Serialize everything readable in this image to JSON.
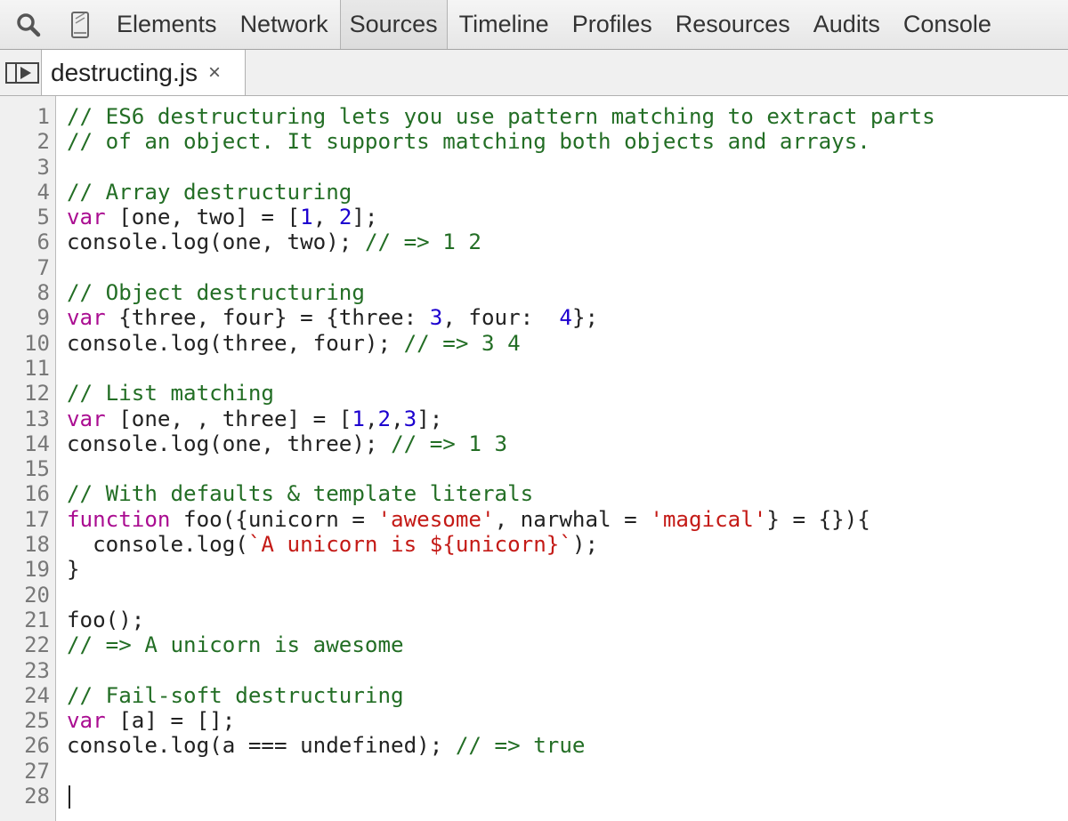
{
  "toolbar": {
    "search_icon": "magnifier-icon",
    "device_icon": "mobile-device-icon",
    "tabs": [
      {
        "label": "Elements",
        "selected": false
      },
      {
        "label": "Network",
        "selected": false
      },
      {
        "label": "Sources",
        "selected": true
      },
      {
        "label": "Timeline",
        "selected": false
      },
      {
        "label": "Profiles",
        "selected": false
      },
      {
        "label": "Resources",
        "selected": false
      },
      {
        "label": "Audits",
        "selected": false
      },
      {
        "label": "Console",
        "selected": false
      }
    ]
  },
  "file_bar": {
    "navigator_icon": "navigator-toggle-icon",
    "file_name": "destructing.js",
    "close_label": "×"
  },
  "colors": {
    "comment": "#236e25",
    "keyword": "#aa0d91",
    "number": "#1c00cf",
    "string": "#c41a16",
    "text": "#222222"
  },
  "editor": {
    "lines": [
      {
        "n": "1",
        "tokens": [
          {
            "t": "comment",
            "v": "// ES6 destructuring lets you use pattern matching to extract parts"
          }
        ]
      },
      {
        "n": "2",
        "tokens": [
          {
            "t": "comment",
            "v": "// of an object. It supports matching both objects and arrays."
          }
        ]
      },
      {
        "n": "3",
        "tokens": []
      },
      {
        "n": "4",
        "tokens": [
          {
            "t": "comment",
            "v": "// Array destructuring"
          }
        ]
      },
      {
        "n": "5",
        "tokens": [
          {
            "t": "keyword",
            "v": "var"
          },
          {
            "t": "plain",
            "v": " [one, two] = ["
          },
          {
            "t": "number",
            "v": "1"
          },
          {
            "t": "plain",
            "v": ", "
          },
          {
            "t": "number",
            "v": "2"
          },
          {
            "t": "plain",
            "v": "];"
          }
        ]
      },
      {
        "n": "6",
        "tokens": [
          {
            "t": "plain",
            "v": "console.log(one, two); "
          },
          {
            "t": "comment",
            "v": "// => 1 2"
          }
        ]
      },
      {
        "n": "7",
        "tokens": []
      },
      {
        "n": "8",
        "tokens": [
          {
            "t": "comment",
            "v": "// Object destructuring"
          }
        ]
      },
      {
        "n": "9",
        "tokens": [
          {
            "t": "keyword",
            "v": "var"
          },
          {
            "t": "plain",
            "v": " {three, four} = {three: "
          },
          {
            "t": "number",
            "v": "3"
          },
          {
            "t": "plain",
            "v": ", four:  "
          },
          {
            "t": "number",
            "v": "4"
          },
          {
            "t": "plain",
            "v": "};"
          }
        ]
      },
      {
        "n": "10",
        "tokens": [
          {
            "t": "plain",
            "v": "console.log(three, four); "
          },
          {
            "t": "comment",
            "v": "// => 3 4"
          }
        ]
      },
      {
        "n": "11",
        "tokens": []
      },
      {
        "n": "12",
        "tokens": [
          {
            "t": "comment",
            "v": "// List matching"
          }
        ]
      },
      {
        "n": "13",
        "tokens": [
          {
            "t": "keyword",
            "v": "var"
          },
          {
            "t": "plain",
            "v": " [one, , three] = ["
          },
          {
            "t": "number",
            "v": "1"
          },
          {
            "t": "plain",
            "v": ","
          },
          {
            "t": "number",
            "v": "2"
          },
          {
            "t": "plain",
            "v": ","
          },
          {
            "t": "number",
            "v": "3"
          },
          {
            "t": "plain",
            "v": "];"
          }
        ]
      },
      {
        "n": "14",
        "tokens": [
          {
            "t": "plain",
            "v": "console.log(one, three); "
          },
          {
            "t": "comment",
            "v": "// => 1 3"
          }
        ]
      },
      {
        "n": "15",
        "tokens": []
      },
      {
        "n": "16",
        "tokens": [
          {
            "t": "comment",
            "v": "// With defaults & template literals"
          }
        ]
      },
      {
        "n": "17",
        "tokens": [
          {
            "t": "keyword",
            "v": "function"
          },
          {
            "t": "plain",
            "v": " foo({unicorn = "
          },
          {
            "t": "string",
            "v": "'awesome'"
          },
          {
            "t": "plain",
            "v": ", narwhal = "
          },
          {
            "t": "string",
            "v": "'magical'"
          },
          {
            "t": "plain",
            "v": "} = {}){"
          }
        ]
      },
      {
        "n": "18",
        "tokens": [
          {
            "t": "plain",
            "v": "  console.log("
          },
          {
            "t": "string",
            "v": "`A unicorn is ${unicorn}`"
          },
          {
            "t": "plain",
            "v": ");"
          }
        ]
      },
      {
        "n": "19",
        "tokens": [
          {
            "t": "plain",
            "v": "}"
          }
        ]
      },
      {
        "n": "20",
        "tokens": []
      },
      {
        "n": "21",
        "tokens": [
          {
            "t": "plain",
            "v": "foo();"
          }
        ]
      },
      {
        "n": "22",
        "tokens": [
          {
            "t": "comment",
            "v": "// => A unicorn is awesome"
          }
        ]
      },
      {
        "n": "23",
        "tokens": []
      },
      {
        "n": "24",
        "tokens": [
          {
            "t": "comment",
            "v": "// Fail-soft destructuring"
          }
        ]
      },
      {
        "n": "25",
        "tokens": [
          {
            "t": "keyword",
            "v": "var"
          },
          {
            "t": "plain",
            "v": " [a] = [];"
          }
        ]
      },
      {
        "n": "26",
        "tokens": [
          {
            "t": "plain",
            "v": "console.log(a === undefined); "
          },
          {
            "t": "comment",
            "v": "// => true"
          }
        ]
      },
      {
        "n": "27",
        "tokens": []
      },
      {
        "n": "28",
        "tokens": [],
        "caret": true
      }
    ]
  }
}
